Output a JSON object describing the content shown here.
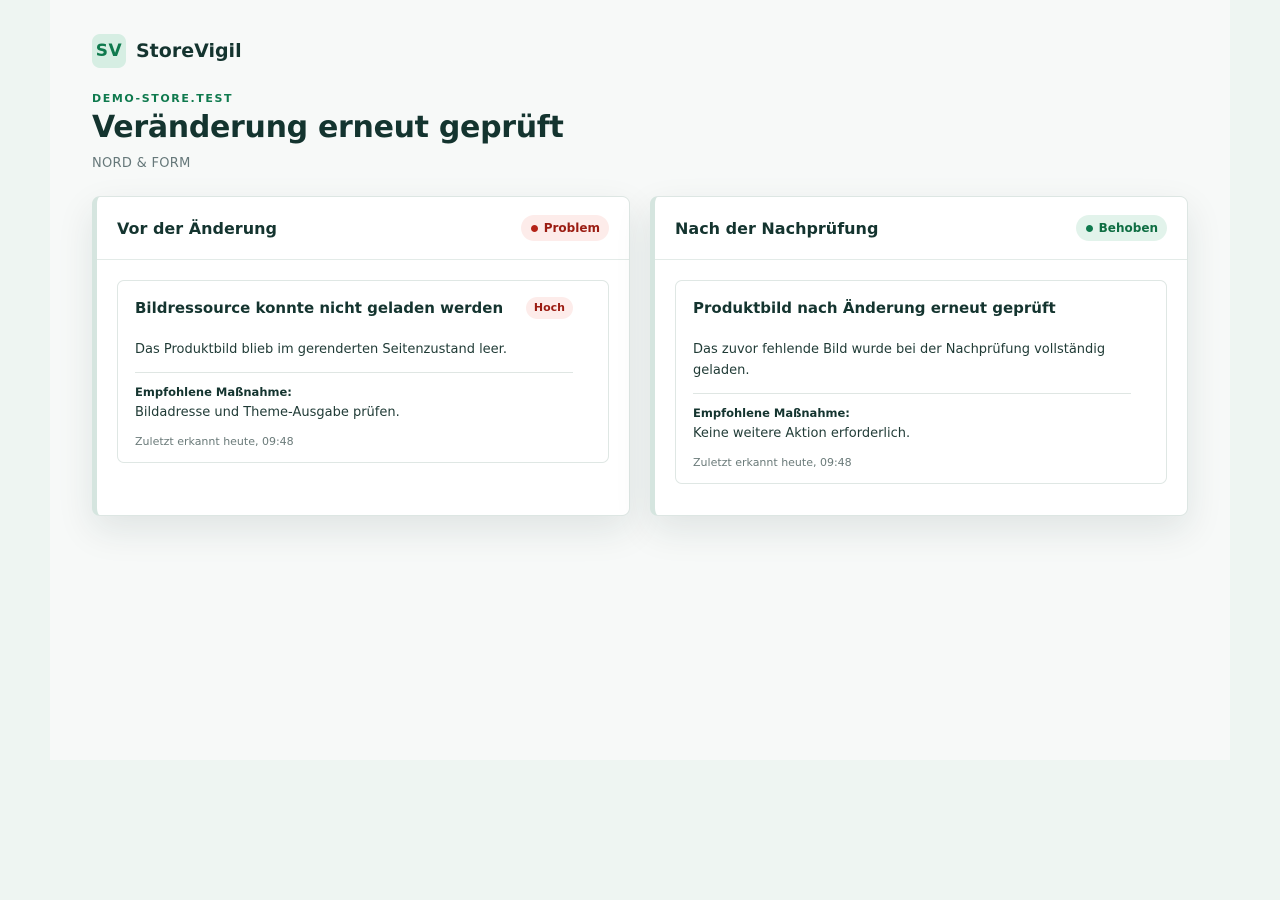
{
  "brand": {
    "logo_text": "SV",
    "name": "StoreVigil"
  },
  "header": {
    "domain": "DEMO-STORE.TEST",
    "title": "Veränderung erneut geprüft",
    "store_name": "NORD & FORM"
  },
  "before": {
    "title": "Vor der Änderung",
    "status": "Problem",
    "finding": {
      "title": "Bildressource konnte nicht geladen werden",
      "severity": "Hoch",
      "description": "Das Produktbild blieb im gerenderten Seitenzustand leer.",
      "action_label": "Empfohlene Maßnahme:",
      "action": "Bildadresse und Theme-Ausgabe prüfen.",
      "last_detected": "Zuletzt erkannt heute, 09:48"
    }
  },
  "after": {
    "title": "Nach der Nachprüfung",
    "status": "Behoben",
    "finding": {
      "title": "Produktbild nach Änderung erneut geprüft",
      "description": "Das zuvor fehlende Bild wurde bei der Nachprüfung vollständig geladen.",
      "action_label": "Empfohlene Maßnahme:",
      "action": "Keine weitere Aktion erforderlich.",
      "last_detected": "Zuletzt erkannt heute, 09:48"
    }
  },
  "colors": {
    "accent": "#0f7a4e",
    "problem": "#b42318",
    "fixed": "#0f7a4e",
    "background": "#eef5f2"
  }
}
